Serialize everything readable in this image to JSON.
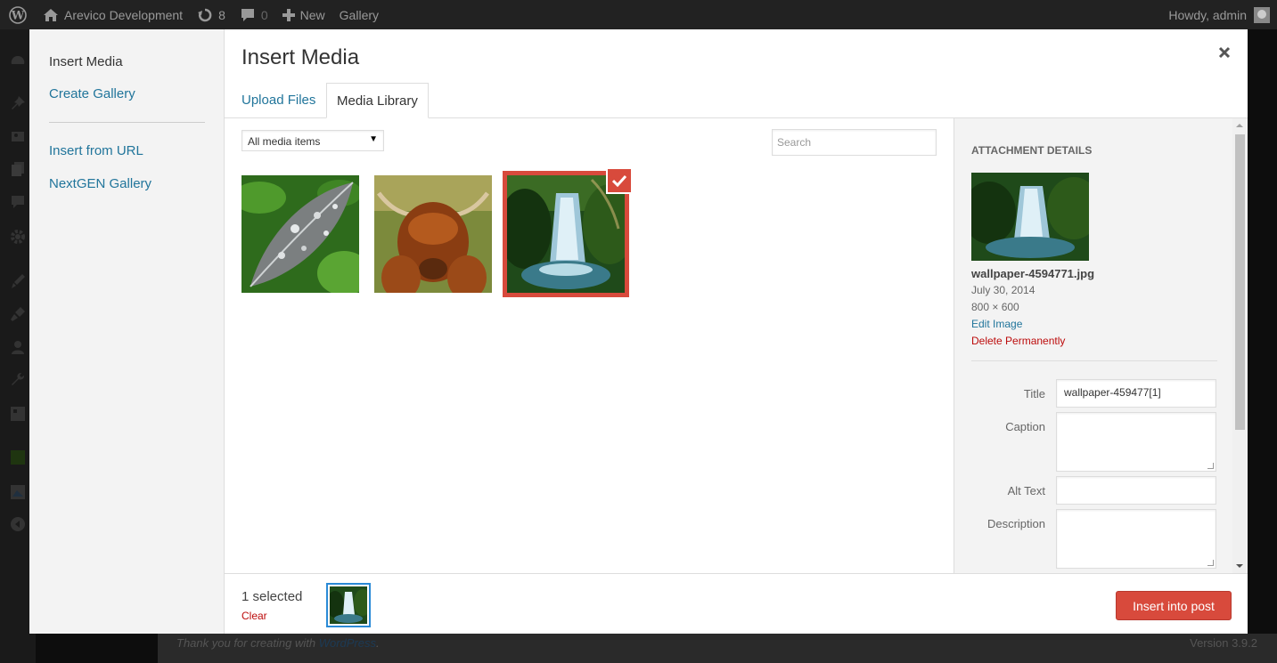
{
  "admin_bar": {
    "site_name": "Arevico Development",
    "updates_count": "8",
    "comments_count": "0",
    "new_label": "New",
    "gallery_label": "Gallery",
    "greeting": "Howdy, admin"
  },
  "footer": {
    "thanks_prefix": "Thank you for creating with ",
    "thanks_link": "WordPress",
    "thanks_suffix": ".",
    "version": "Version 3.9.2"
  },
  "modal": {
    "menu": {
      "insert_media": "Insert Media",
      "create_gallery": "Create Gallery",
      "insert_from_url": "Insert from URL",
      "nextgen_gallery": "NextGEN Gallery"
    },
    "title": "Insert Media",
    "tabs": {
      "upload": "Upload Files",
      "library": "Media Library"
    },
    "filter": {
      "selected": "All media items"
    },
    "search": {
      "placeholder": "Search"
    },
    "attachment": {
      "heading": "Attachment Details",
      "filename": "wallpaper-4594771.jpg",
      "date": "July 30, 2014",
      "dimensions": "800 × 600",
      "edit_link": "Edit Image",
      "delete_link": "Delete Permanently",
      "title_label": "Title",
      "title_value": "wallpaper-459477[1]",
      "caption_label": "Caption",
      "caption_value": "",
      "alt_label": "Alt Text",
      "alt_value": "",
      "description_label": "Description",
      "description_value": ""
    },
    "toolbar": {
      "selected_count": "1 selected",
      "clear_label": "Clear",
      "insert_button": "Insert into post"
    }
  },
  "colors": {
    "accent": "#d84a3c",
    "link": "#21759b",
    "danger": "#bc0b0b"
  }
}
